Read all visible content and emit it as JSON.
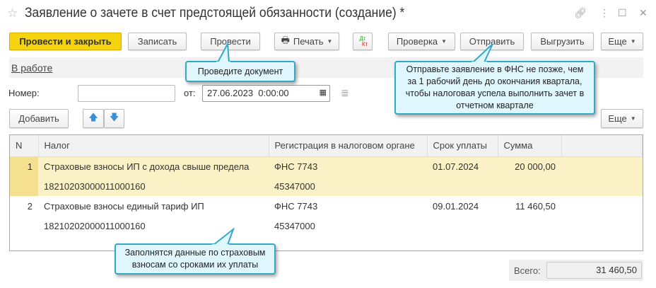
{
  "window": {
    "title": "Заявление о зачете в счет предстоящей обязанности (создание) *"
  },
  "toolbar": {
    "post_close": "Провести и закрыть",
    "save": "Записать",
    "post": "Провести",
    "print": "Печать",
    "dtkt_dt": "Дт",
    "dtkt_kt": "Кт",
    "check": "Проверка",
    "send": "Отправить",
    "export": "Выгрузить",
    "more": "Еще"
  },
  "status_link": "В работе",
  "form": {
    "number_label": "Номер:",
    "number_value": "",
    "date_label": "от:",
    "date_value": "27.06.2023  0:00:00"
  },
  "table_toolbar": {
    "add": "Добавить",
    "more": "Еще"
  },
  "table": {
    "columns": [
      "N",
      "Налог",
      "Регистрация в налоговом органе",
      "Срок уплаты",
      "Сумма"
    ],
    "rows": [
      {
        "n": "1",
        "tax": "Страховые взносы ИП с дохода свыше предела",
        "kbk": "18210203000011000160",
        "reg": "ФНС 7743",
        "oktmo": "45347000",
        "due": "01.07.2024",
        "sum": "20 000,00"
      },
      {
        "n": "2",
        "tax": "Страховые взносы единый тариф ИП",
        "kbk": "18210202000011000160",
        "reg": "ФНС 7743",
        "oktmo": "45347000",
        "due": "09.01.2024",
        "sum": "11 460,50"
      }
    ]
  },
  "total": {
    "label": "Всего:",
    "value": "31 460,50"
  },
  "tooltips": {
    "post": "Проведите документ",
    "send": "Отправьте заявление в ФНС не позже, чем за 1 рабочий день до окончания квартала, чтобы налоговая успела выполнить зачет в отчетном квартале",
    "table": "Заполнятся данные по страховым взносам со сроками их уплаты"
  },
  "colors": {
    "primary": "#f5d30f",
    "tooltip_bg": "#dff6fc",
    "tooltip_border": "#34a9c5",
    "selected_row": "#fbf1c6"
  }
}
